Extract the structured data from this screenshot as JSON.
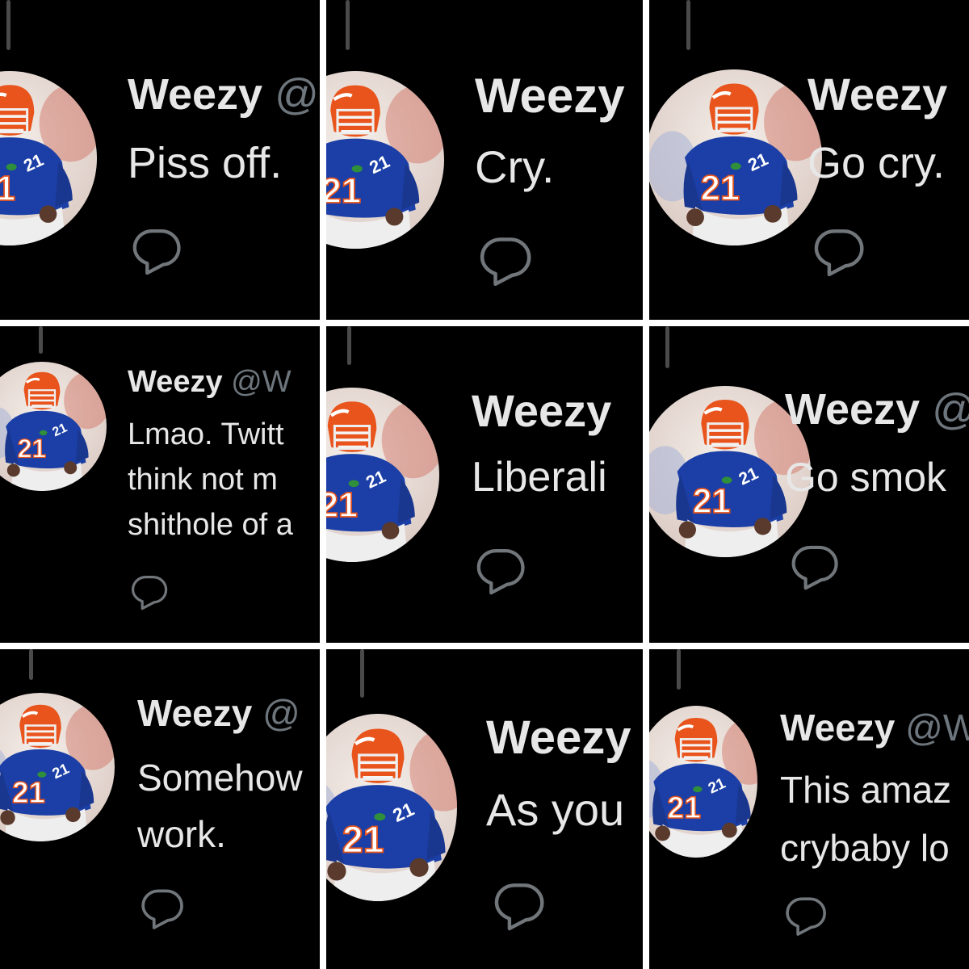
{
  "tweets": [
    {
      "name": "Weezy",
      "handle": "@",
      "lines": [
        "Piss off."
      ]
    },
    {
      "name": "Weezy",
      "handle": "",
      "lines": [
        "Cry."
      ]
    },
    {
      "name": "Weezy",
      "handle": "",
      "lines": [
        "Go cry."
      ]
    },
    {
      "name": "Weezy",
      "handle": "@W",
      "lines": [
        "Lmao. Twitt",
        "think not m",
        "shithole of a"
      ]
    },
    {
      "name": "Weezy",
      "handle": "",
      "lines": [
        "Liberali"
      ]
    },
    {
      "name": "Weezy",
      "handle": "@",
      "lines": [
        "Go smok"
      ]
    },
    {
      "name": "Weezy",
      "handle": "@",
      "lines": [
        "Somehow",
        "work."
      ]
    },
    {
      "name": "Weezy",
      "handle": "",
      "lines": [
        "As you"
      ]
    },
    {
      "name": "Weezy",
      "handle": "@W",
      "lines": [
        "This amaz",
        "crybaby lo"
      ]
    }
  ],
  "icons": {
    "avatar": "profile-photo-football-player",
    "reply": "speech-bubble-icon"
  },
  "colors": {
    "background": "#000000",
    "text": "#e7e7e7",
    "handle": "#6e767d",
    "icon": "#71767b",
    "jersey": "#1b3fa6",
    "helmet": "#e8541c"
  }
}
